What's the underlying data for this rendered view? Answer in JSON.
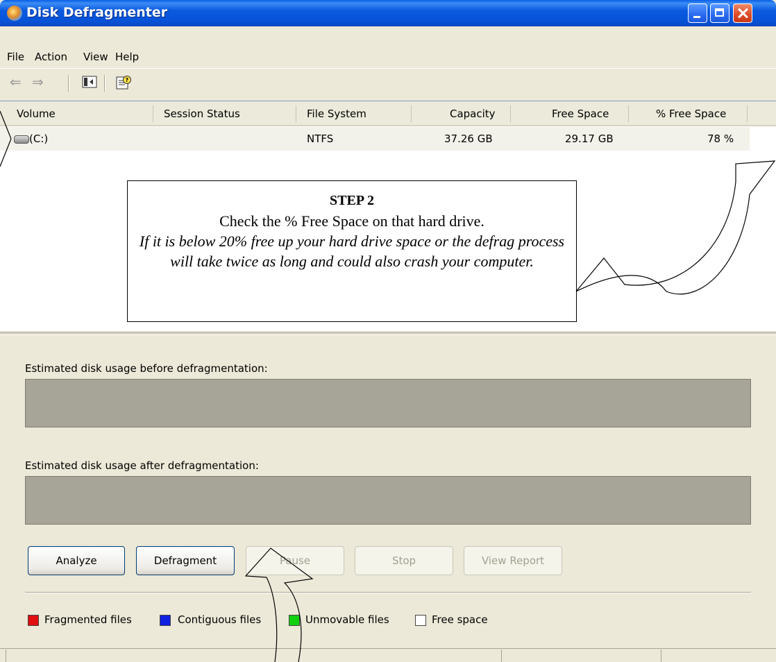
{
  "window": {
    "title": "Disk Defragmenter"
  },
  "menu": {
    "items": [
      "File",
      "Action",
      "View",
      "Help"
    ]
  },
  "toolbar": {
    "icons": [
      "back-arrow-icon",
      "forward-arrow-icon",
      "show-hide-console-tree-icon",
      "help-icon"
    ]
  },
  "volume_list": {
    "columns": [
      "Volume",
      "Session Status",
      "File System",
      "Capacity",
      "Free Space",
      "% Free Space"
    ],
    "rows": [
      {
        "volume": "(C:)",
        "session_status": "",
        "file_system": "NTFS",
        "capacity": "37.26 GB",
        "free_space": "29.17 GB",
        "pct_free": "78 %"
      }
    ]
  },
  "callout": {
    "step": "STEP 2",
    "lead": "Check the % Free Space on that hard drive.",
    "warning": "If it is below 20% free up your hard drive space or the defrag process will take twice as long and could also crash your computer."
  },
  "usage": {
    "before_label": "Estimated disk usage before defragmentation:",
    "after_label": "Estimated disk usage after defragmentation:"
  },
  "buttons": {
    "analyze": "Analyze",
    "defragment": "Defragment",
    "pause": "Pause",
    "stop": "Stop",
    "view_report": "View Report"
  },
  "legend": [
    {
      "label": "Fragmented files",
      "color": "#e01010"
    },
    {
      "label": "Contiguous files",
      "color": "#1020e0"
    },
    {
      "label": "Unmovable files",
      "color": "#10d010"
    },
    {
      "label": "Free space",
      "color": "#ffffff"
    }
  ]
}
